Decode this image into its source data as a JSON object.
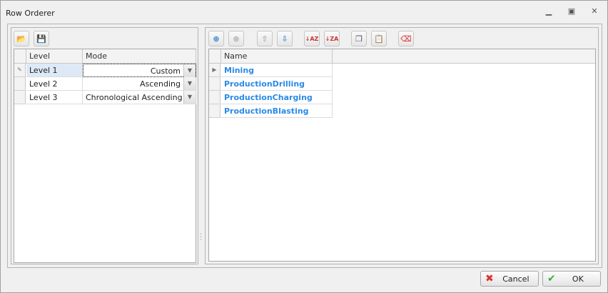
{
  "window": {
    "title": "Row Orderer"
  },
  "levels_grid": {
    "columns": [
      "Level",
      "Mode"
    ],
    "rows": [
      {
        "level": "Level 1",
        "mode": "Custom"
      },
      {
        "level": "Level 2",
        "mode": "Ascending"
      },
      {
        "level": "Level 3",
        "mode": "Chronological Ascending"
      }
    ]
  },
  "names_grid": {
    "column": "Name",
    "rows": [
      "Mining",
      "ProductionDrilling",
      "ProductionCharging",
      "ProductionBlasting"
    ]
  },
  "buttons": {
    "cancel": "Cancel",
    "ok": "OK"
  },
  "colors": {
    "name_text": "#2b8ae6"
  }
}
